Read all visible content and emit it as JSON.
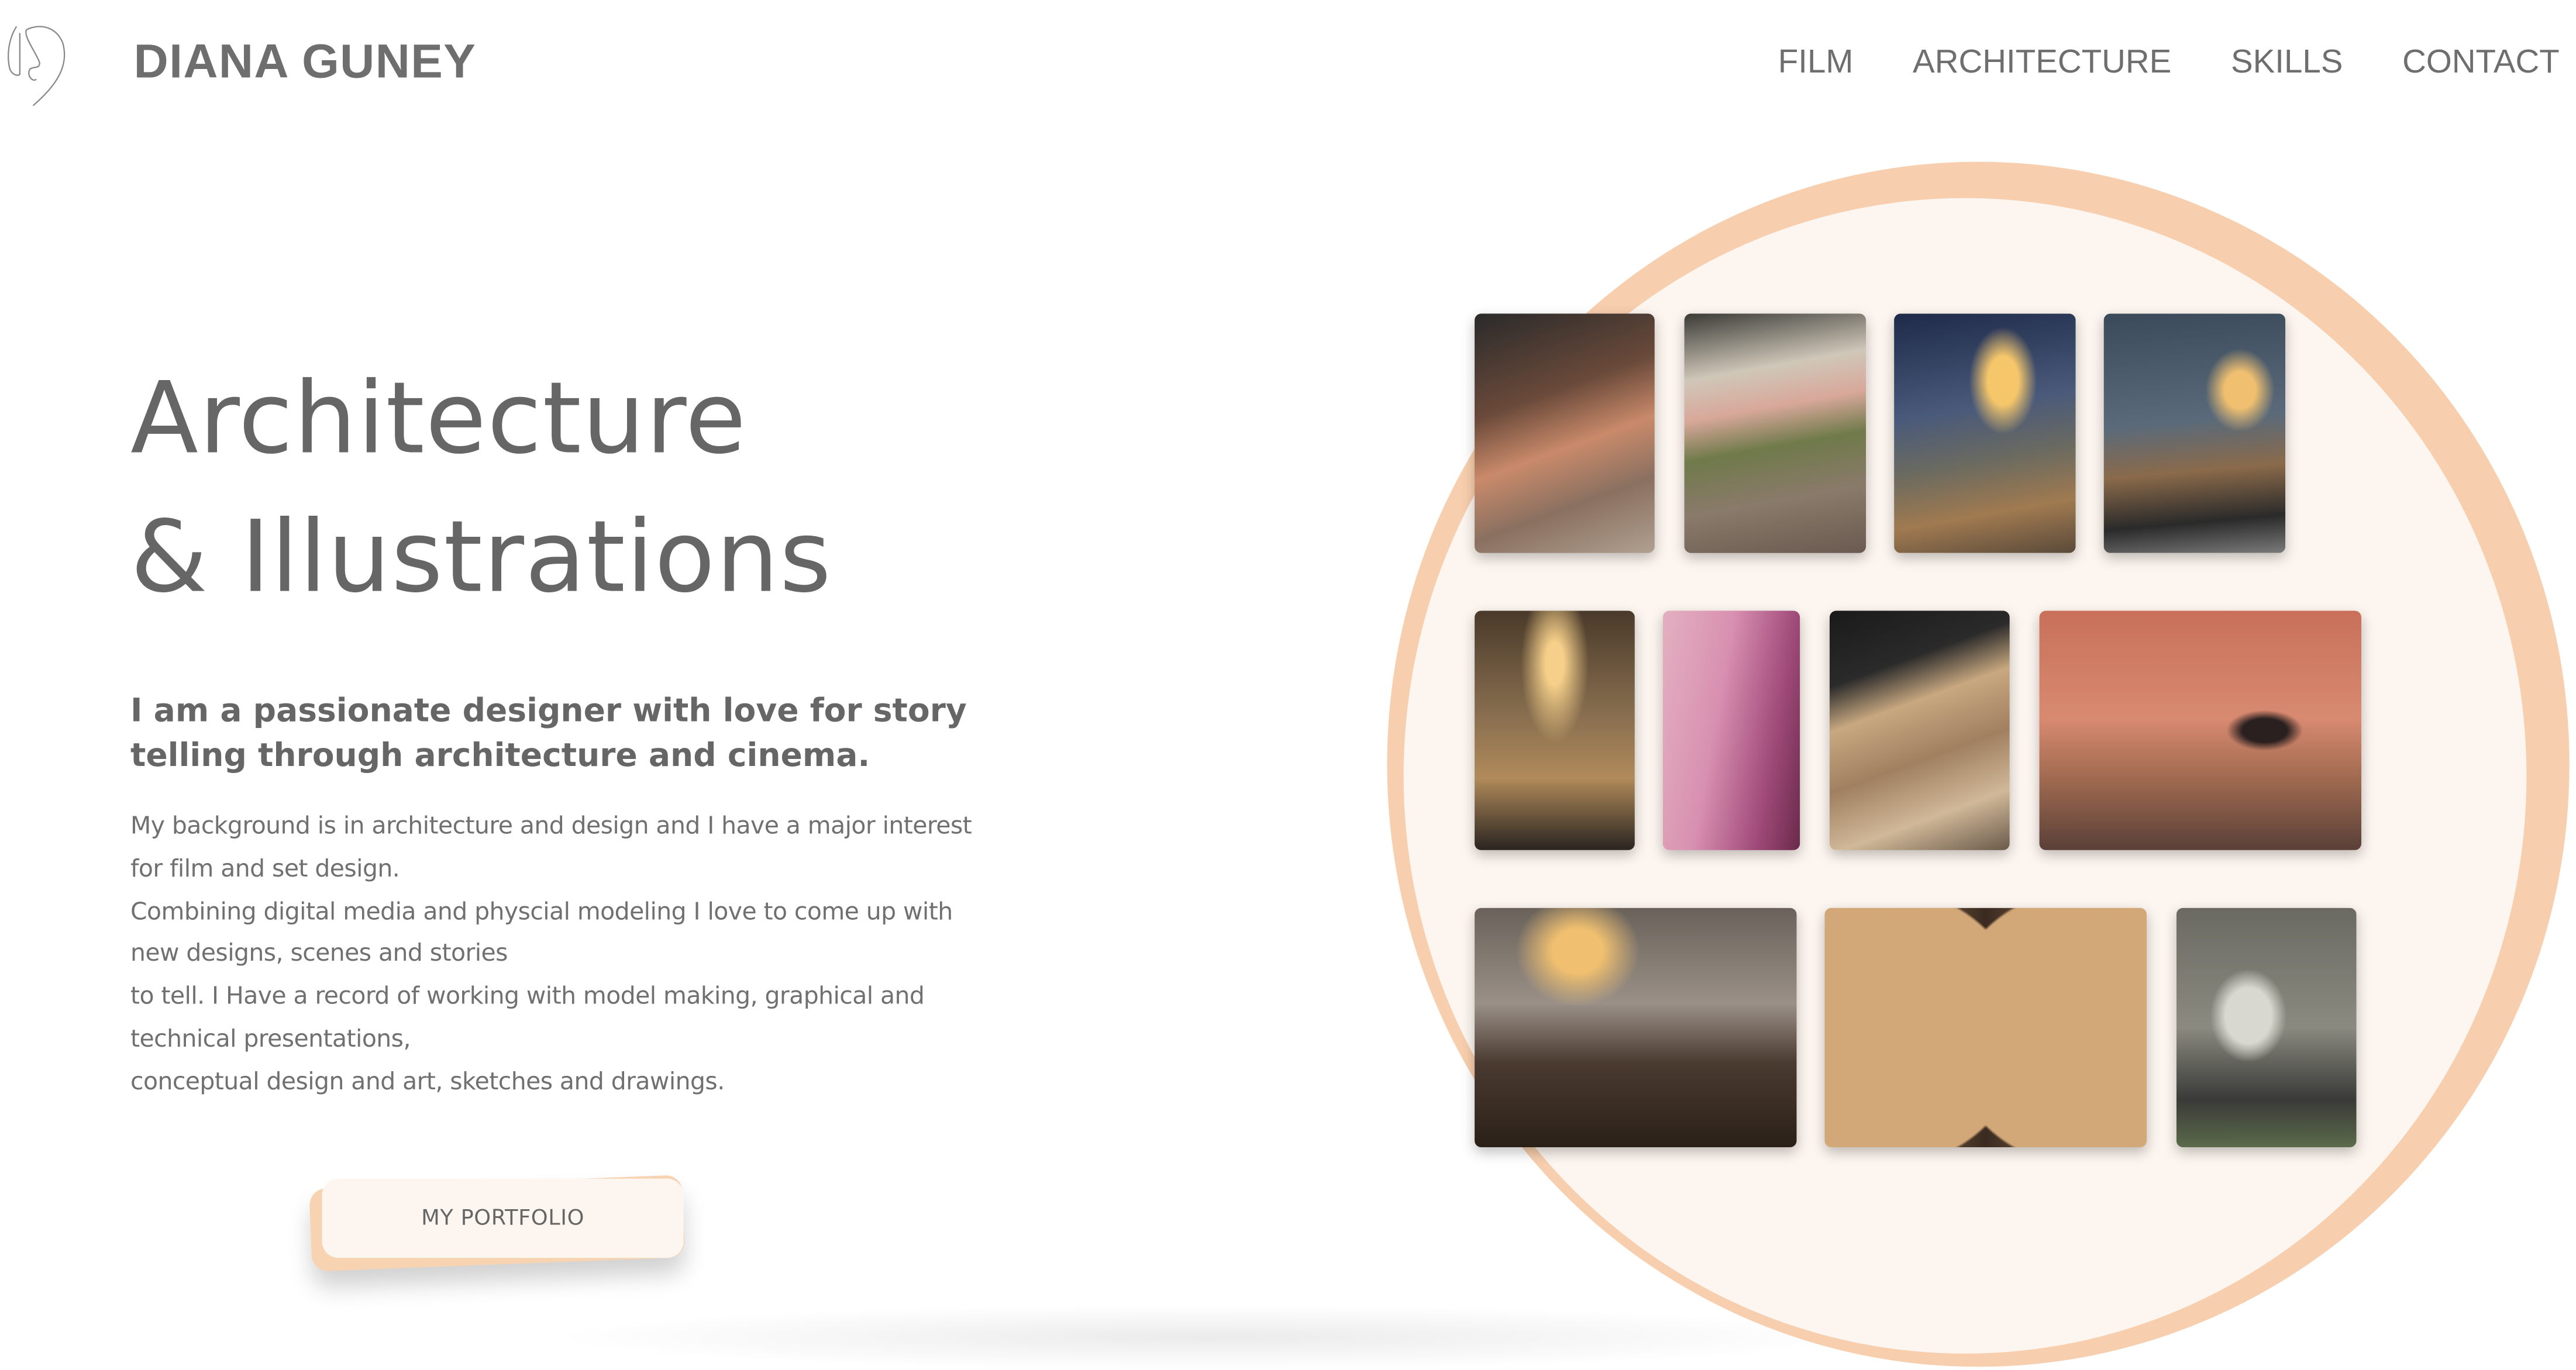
{
  "header": {
    "logo_alt": "DG signature logo",
    "brand": "DIANA GUNEY",
    "nav": [
      {
        "label": "FILM"
      },
      {
        "label": "ARCHITECTURE"
      },
      {
        "label": "SKILLS"
      },
      {
        "label": "CONTACT"
      }
    ]
  },
  "hero": {
    "title_line1": "Architecture",
    "title_line2": "& Illustrations",
    "subtitle": "I am a passionate designer with love for story telling through architecture and cinema.",
    "body_lines": [
      "My background is in architecture and design and I have a major interest",
      "for film and set design.",
      "Combining digital media and physcial modeling I love to come up with",
      "new designs, scenes and stories",
      "to tell. I Have a record of working with model making, graphical and",
      "technical presentations,",
      "conceptual design and art, sketches and drawings."
    ],
    "cta_label": "MY PORTFOLIO"
  },
  "gallery": {
    "accent_color": "#f7cfae",
    "background_color": "#fdf5ef",
    "photos": [
      {
        "name": "photo-bar-counter-pink"
      },
      {
        "name": "photo-bar-plants"
      },
      {
        "name": "photo-pendant-lamp-window"
      },
      {
        "name": "photo-window-bar-stools"
      },
      {
        "name": "photo-wall-lamp-table"
      },
      {
        "name": "photo-pink-light-corner"
      },
      {
        "name": "photo-wood-structure"
      },
      {
        "name": "photo-orange-wall-seated-woman"
      },
      {
        "name": "photo-dining-room-lamps"
      },
      {
        "name": "photo-wooden-doors"
      },
      {
        "name": "photo-mirror-sink"
      }
    ]
  }
}
